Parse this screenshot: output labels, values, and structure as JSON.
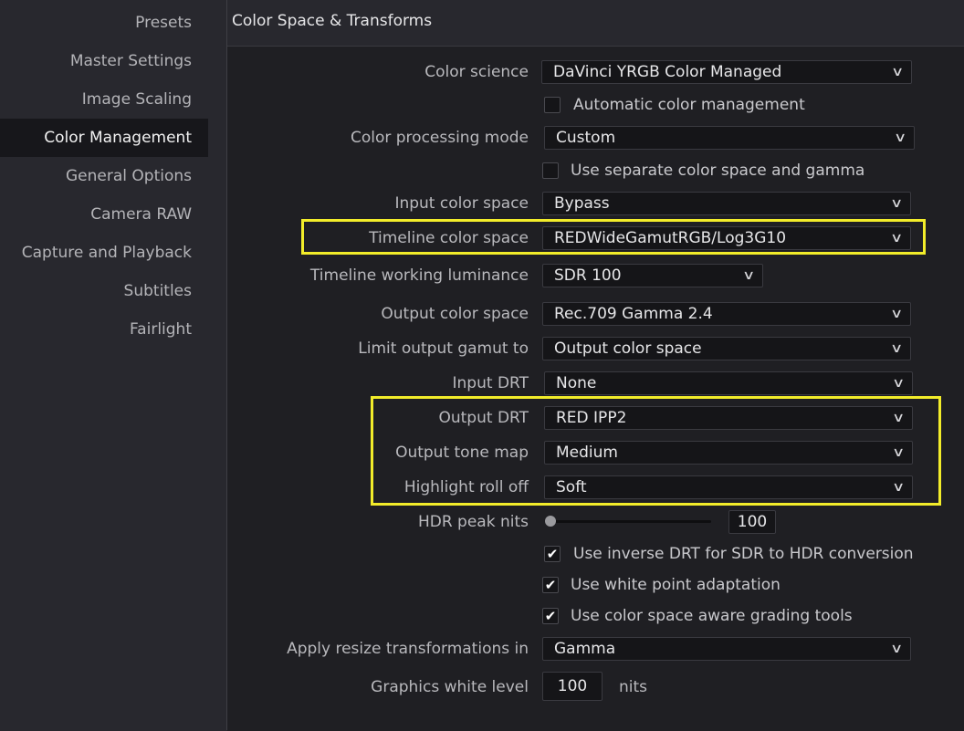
{
  "sidebar": {
    "items": [
      {
        "label": "Presets"
      },
      {
        "label": "Master Settings"
      },
      {
        "label": "Image Scaling"
      },
      {
        "label": "Color Management",
        "active": true
      },
      {
        "label": "General Options"
      },
      {
        "label": "Camera RAW"
      },
      {
        "label": "Capture and Playback"
      },
      {
        "label": "Subtitles"
      },
      {
        "label": "Fairlight"
      }
    ]
  },
  "section": {
    "title": "Color Space & Transforms"
  },
  "fields": {
    "color_science": {
      "label": "Color science",
      "value": "DaVinci YRGB Color Managed"
    },
    "auto_cm": {
      "label": "Automatic color management",
      "checked": false
    },
    "processing_mode": {
      "label": "Color processing mode",
      "value": "Custom"
    },
    "separate_cs": {
      "label": "Use separate color space and gamma",
      "checked": false
    },
    "input_cs": {
      "label": "Input color space",
      "value": "Bypass"
    },
    "timeline_cs": {
      "label": "Timeline color space",
      "value": "REDWideGamutRGB/Log3G10"
    },
    "timeline_lum": {
      "label": "Timeline working luminance",
      "value": "SDR 100"
    },
    "output_cs": {
      "label": "Output color space",
      "value": "Rec.709 Gamma 2.4"
    },
    "limit_gamut": {
      "label": "Limit output gamut to",
      "value": "Output color space"
    },
    "input_drt": {
      "label": "Input DRT",
      "value": "None"
    },
    "output_drt": {
      "label": "Output DRT",
      "value": "RED IPP2"
    },
    "tone_map": {
      "label": "Output tone map",
      "value": "Medium"
    },
    "rolloff": {
      "label": "Highlight roll off",
      "value": "Soft"
    },
    "hdr_peak": {
      "label": "HDR peak nits",
      "value": "100"
    },
    "inverse_drt": {
      "label": "Use inverse DRT for SDR to HDR conversion",
      "checked": true
    },
    "white_point": {
      "label": "Use white point adaptation",
      "checked": true
    },
    "cs_aware": {
      "label": "Use color space aware grading tools",
      "checked": true
    },
    "resize": {
      "label": "Apply resize transformations in",
      "value": "Gamma"
    },
    "gfx_white": {
      "label": "Graphics white level",
      "value": "100",
      "unit": "nits"
    }
  },
  "icons": {
    "dropdown": "chevron-down-icon",
    "check": "checkmark-icon"
  },
  "colors": {
    "highlight": "#f2ec2a",
    "panel": "#1f1f23",
    "active_item": "#17171b"
  }
}
